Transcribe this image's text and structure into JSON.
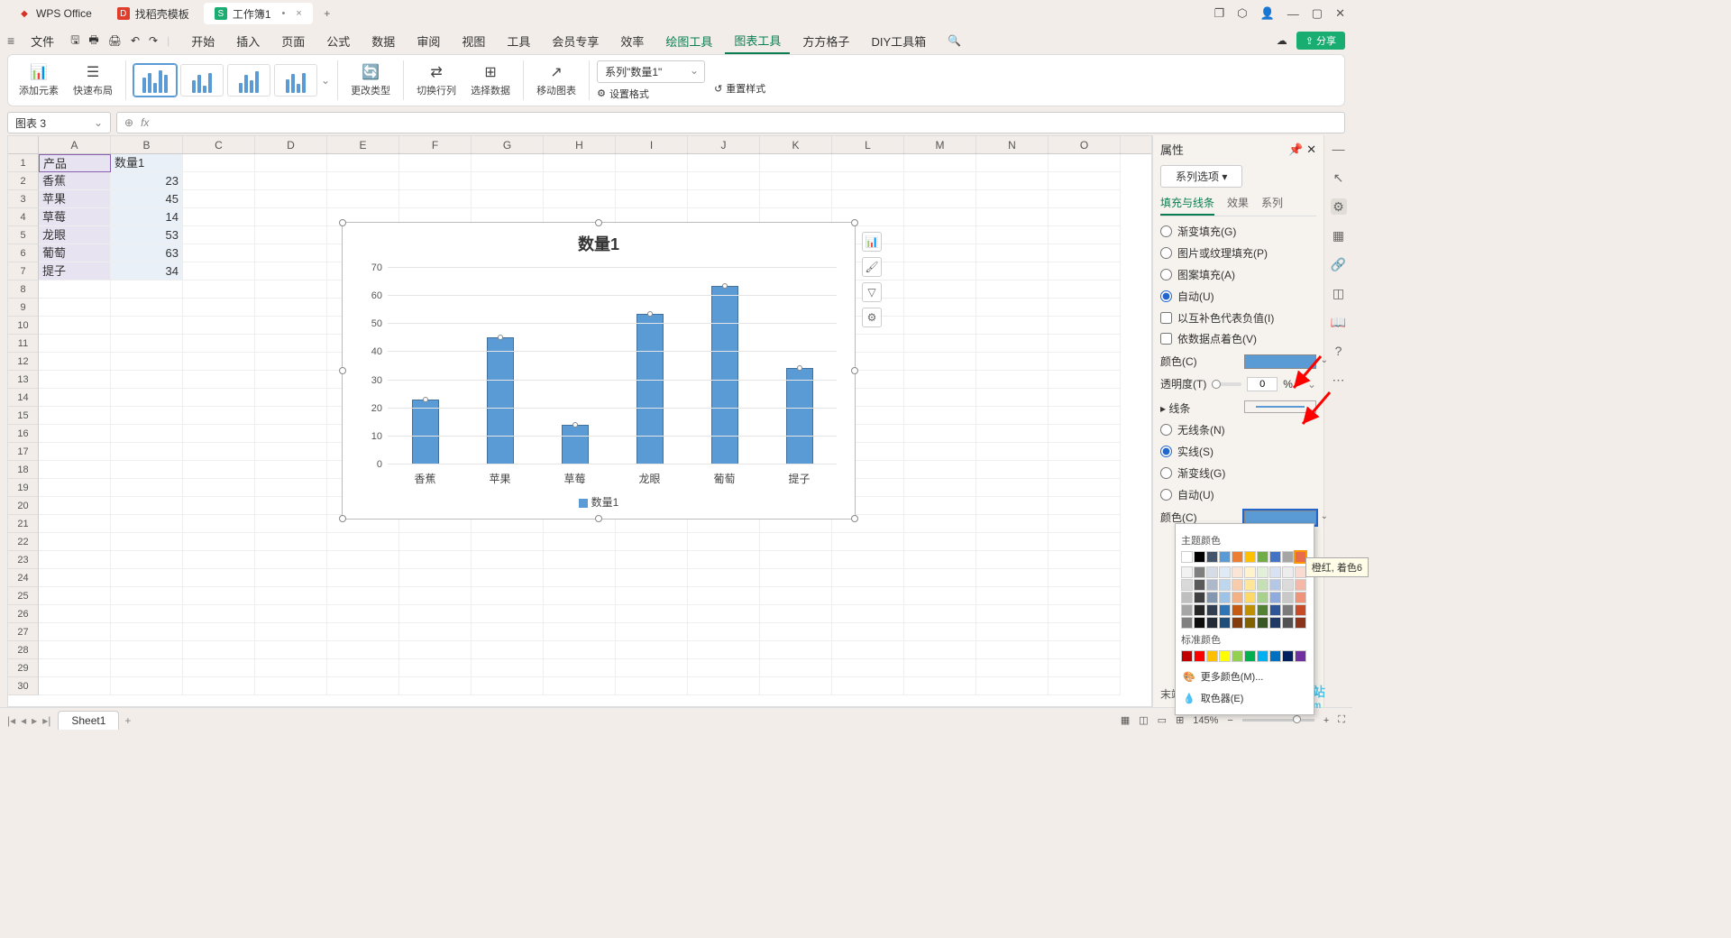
{
  "titlebar": {
    "app_name": "WPS Office",
    "tab2": "找稻壳模板",
    "tab3": "工作簿1",
    "close": "×",
    "add": "+"
  },
  "menubar": {
    "file": "文件",
    "items": [
      "开始",
      "插入",
      "页面",
      "公式",
      "数据",
      "审阅",
      "视图",
      "工具",
      "会员专享",
      "效率",
      "绘图工具",
      "图表工具",
      "方方格子",
      "DIY工具箱"
    ],
    "share": "分享"
  },
  "ribbon": {
    "add_element": "添加元素",
    "quick_layout": "快速布局",
    "change_type": "更改类型",
    "switch_rowcol": "切换行列",
    "select_data": "选择数据",
    "move_chart": "移动图表",
    "series_select": "系列\"数量1\"",
    "set_format": "设置格式",
    "reset_style": "重置样式"
  },
  "namebox": "图表 3",
  "fx": "fx",
  "sheet": {
    "cols": [
      "A",
      "B",
      "C",
      "D",
      "E",
      "F",
      "G",
      "H",
      "I",
      "J",
      "K",
      "L",
      "M",
      "N",
      "O"
    ],
    "headers": {
      "a": "产品",
      "b": "数量1"
    },
    "data": [
      {
        "a": "香蕉",
        "b": "23"
      },
      {
        "a": "苹果",
        "b": "45"
      },
      {
        "a": "草莓",
        "b": "14"
      },
      {
        "a": "龙眼",
        "b": "53"
      },
      {
        "a": "葡萄",
        "b": "63"
      },
      {
        "a": "提子",
        "b": "34"
      }
    ]
  },
  "chart_data": {
    "type": "bar",
    "title": "数量1",
    "categories": [
      "香蕉",
      "苹果",
      "草莓",
      "龙眼",
      "葡萄",
      "提子"
    ],
    "values": [
      23,
      45,
      14,
      53,
      63,
      34
    ],
    "y_ticks": [
      0,
      10,
      20,
      30,
      40,
      50,
      60,
      70
    ],
    "ylim": [
      0,
      70
    ],
    "legend": "数量1",
    "bar_color": "#5b9bd5"
  },
  "props": {
    "title": "属性",
    "series_options": "系列选项",
    "tabs": {
      "fill": "填充与线条",
      "effect": "效果",
      "series": "系列"
    },
    "gradient_fill": "渐变填充(G)",
    "picture_fill": "图片或纹理填充(P)",
    "pattern_fill": "图案填充(A)",
    "auto": "自动(U)",
    "invert_neg": "以互补色代表负值(I)",
    "vary_colors": "依数据点着色(V)",
    "color_label": "颜色(C)",
    "transparency": "透明度(T)",
    "trans_val": "0",
    "trans_unit": "%",
    "line_section": "线条",
    "no_line": "无线条(N)",
    "solid_line": "实线(S)",
    "gradient_line": "渐变线(G)",
    "auto_line": "自动(U)",
    "end_arrow": "末端箭头(N)"
  },
  "color_popup": {
    "theme_title": "主题颜色",
    "standard_title": "标准颜色",
    "more_colors": "更多颜色(M)...",
    "eyedropper": "取色器(E)",
    "tooltip": "橙红, 着色6",
    "theme_row1": [
      "#ffffff",
      "#000000",
      "#44546a",
      "#5b9bd5",
      "#ed7d31",
      "#ffc000",
      "#70ad47",
      "#4472c4",
      "#a5a5a5",
      "#e86c4b"
    ],
    "theme_shades": [
      [
        "#f2f2f2",
        "#7f7f7f",
        "#d6dce5",
        "#deebf7",
        "#fbe5d6",
        "#fff2cc",
        "#e2f0d9",
        "#d9e2f3",
        "#ededed",
        "#fadbd2"
      ],
      [
        "#d9d9d9",
        "#595959",
        "#adb9ca",
        "#bdd7ee",
        "#f8cbad",
        "#ffe699",
        "#c5e0b4",
        "#b4c7e7",
        "#dbdbdb",
        "#f5b8a6"
      ],
      [
        "#bfbfbf",
        "#404040",
        "#8497b0",
        "#9dc3e6",
        "#f4b183",
        "#ffd966",
        "#a9d18e",
        "#8faadc",
        "#c9c9c9",
        "#ef9479"
      ],
      [
        "#a6a6a6",
        "#262626",
        "#333f50",
        "#2e75b6",
        "#c55a11",
        "#bf9000",
        "#548235",
        "#2f5597",
        "#7b7b7b",
        "#c74b27"
      ],
      [
        "#808080",
        "#0d0d0d",
        "#222a35",
        "#1f4e79",
        "#843c0c",
        "#806000",
        "#385723",
        "#203864",
        "#525252",
        "#8a341b"
      ]
    ],
    "standard": [
      "#c00000",
      "#ff0000",
      "#ffc000",
      "#ffff00",
      "#92d050",
      "#00b050",
      "#00b0f0",
      "#0070c0",
      "#002060",
      "#7030a0"
    ]
  },
  "bottom": {
    "sheet1": "Sheet1",
    "zoom": "145%",
    "watermark": "极光下载站",
    "watermark_url": "www.xz7.com"
  }
}
